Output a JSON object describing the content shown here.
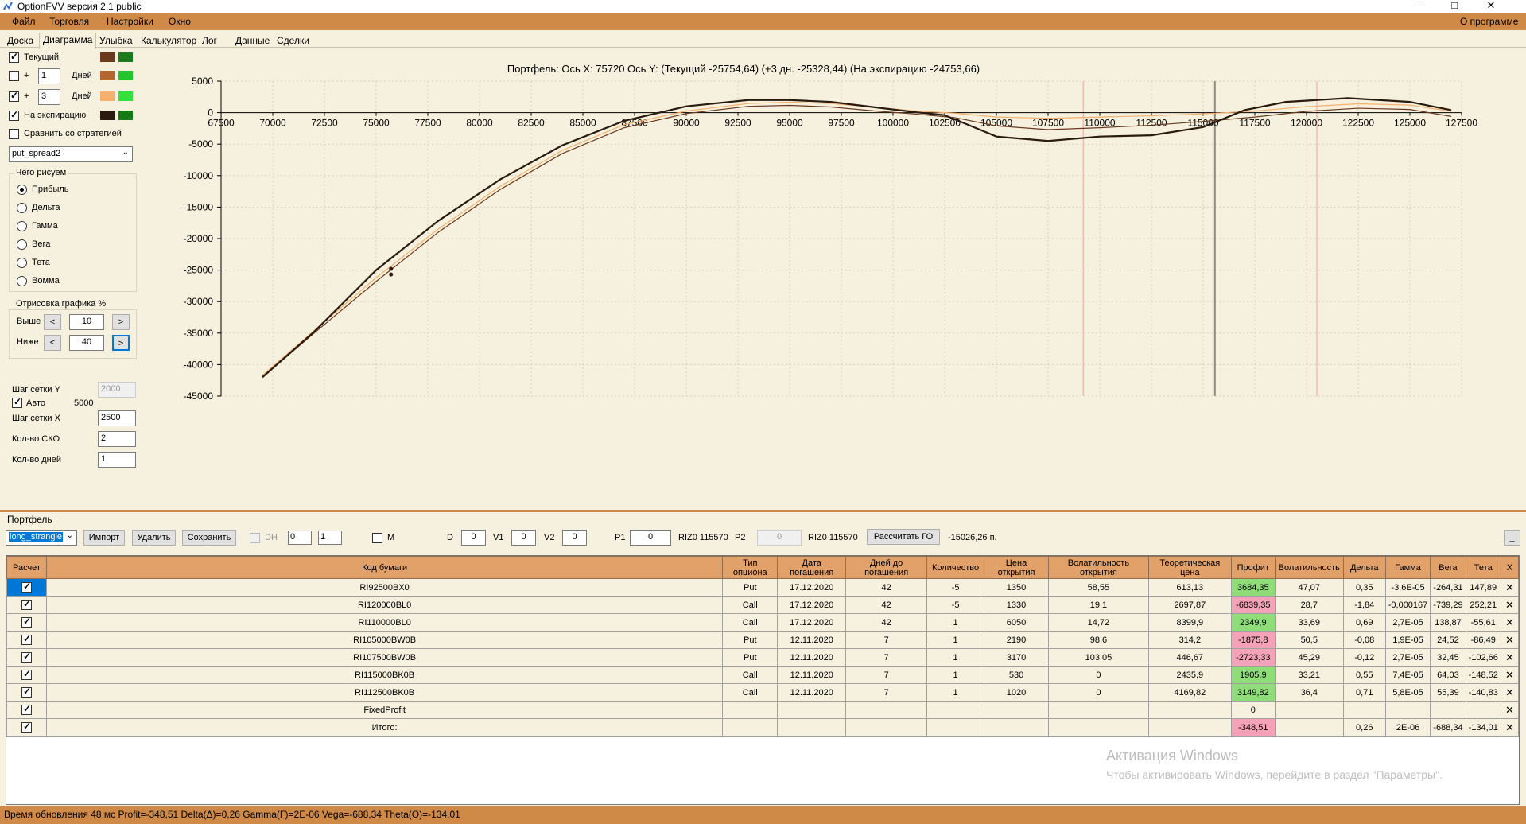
{
  "window": {
    "title": "OptionFVV версия 2.1 public",
    "minimize": "–",
    "maximize": "□",
    "close": "✕"
  },
  "menu": {
    "items": [
      "Файл",
      "Торговля",
      "Настройки",
      "Окно"
    ],
    "about": "О программе"
  },
  "tabs": [
    "Доска",
    "Диаграмма",
    "Улыбка",
    "Калькулятор",
    "Лог",
    "Данные",
    "Сделки"
  ],
  "active_tab": "Диаграмма",
  "left_panel": {
    "current_label": "Текущий",
    "plus": "+",
    "days_label": "Дней",
    "days1_value": "1",
    "days2_value": "3",
    "expiry_label": "На экспирацию",
    "compare_label": "Сравнить со стратегией",
    "strategy_value": "put_spread2",
    "draw_group_title": "Чего рисуем",
    "draw_options": [
      "Прибыль",
      "Дельта",
      "Гамма",
      "Вега",
      "Тета",
      "Вомма"
    ],
    "render_group_title": "Отрисовка графика %",
    "above_label": "Выше",
    "above_value": "10",
    "below_label": "Ниже",
    "below_value": "40",
    "prev": "<",
    "next": ">",
    "grid_y_label": "Шаг сетки Y",
    "grid_y_value": "2000",
    "auto_label": "Авто",
    "auto_value": "5000",
    "grid_x_label": "Шаг сетки X",
    "grid_x_value": "2500",
    "sko_label": "Кол-во СКО",
    "sko_value": "2",
    "days_count_label": "Кол-во дней",
    "days_count_value": "1",
    "colors": {
      "current_1": "#6B3A1E",
      "current_2": "#1D7A1D",
      "plus1_1": "#B5662E",
      "plus1_2": "#22C52C",
      "plus3_1": "#F5B06E",
      "plus3_2": "#36E03A",
      "expiry_1": "#2A1A10",
      "expiry_2": "#137A16"
    }
  },
  "chart_data": {
    "type": "line",
    "title": "Портфель: Ось X: 75720 Ось Y: (Текущий -25754,64) (+3 дн. -25328,44) (На экспирацию -24753,66)",
    "x_ticks": [
      "67500",
      "70000",
      "72500",
      "75000",
      "77500",
      "80000",
      "82500",
      "85000",
      "87500",
      "90000",
      "92500",
      "95000",
      "97500",
      "100000",
      "102500",
      "105000",
      "107500",
      "110000",
      "112500",
      "115000",
      "117500",
      "120000",
      "122500",
      "125000",
      "127500"
    ],
    "y_ticks": [
      "5000",
      "0",
      "-5000",
      "-10000",
      "-15000",
      "-20000",
      "-25000",
      "-30000",
      "-35000",
      "-40000",
      "-45000"
    ],
    "xlim": [
      67500,
      127500
    ],
    "ylim": [
      -45000,
      5000
    ],
    "grid": true,
    "cursor_x": 75720,
    "sd_lines": [
      109200,
      115570,
      120500
    ],
    "series": [
      {
        "color": "#6B3A1E",
        "x": [
          69500,
          72000,
          75000,
          78000,
          81000,
          84000,
          87000,
          90000,
          93000,
          95000,
          97000,
          99000,
          101000,
          103000,
          105000,
          107500,
          110000,
          112500,
          115000,
          117500,
          120000,
          122500,
          125000,
          127000
        ],
        "y": [
          -42000,
          -35000,
          -26800,
          -19000,
          -12200,
          -6500,
          -2400,
          -150,
          1000,
          1150,
          900,
          300,
          -200,
          -800,
          -2100,
          -2700,
          -2400,
          -2000,
          -1400,
          -700,
          200,
          700,
          500,
          -600
        ]
      },
      {
        "color": "#F5B06E",
        "x": [
          69500,
          72000,
          75000,
          78000,
          81000,
          84000,
          87000,
          90000,
          93000,
          95000,
          97000,
          99000,
          101000,
          103000,
          105000,
          107500,
          110000,
          112500,
          115000,
          117500,
          120000,
          122500,
          125000,
          127000
        ],
        "y": [
          -41700,
          -34600,
          -26200,
          -18500,
          -11700,
          -6000,
          -1900,
          250,
          1450,
          1650,
          1450,
          900,
          300,
          -100,
          -700,
          -900,
          -700,
          -500,
          -200,
          250,
          950,
          1400,
          1200,
          200
        ]
      },
      {
        "color": "#2A1A10",
        "x": [
          69500,
          72000,
          75000,
          78000,
          81000,
          84000,
          87000,
          90000,
          93000,
          95000,
          97000,
          99000,
          101000,
          102500,
          105000,
          107500,
          110000,
          112500,
          115000,
          117000,
          119000,
          122000,
          125000,
          127000
        ],
        "y": [
          -42000,
          -34800,
          -25000,
          -17200,
          -10600,
          -5200,
          -1300,
          1000,
          2000,
          2000,
          1700,
          900,
          100,
          -400,
          -3800,
          -4500,
          -3800,
          -3600,
          -2300,
          400,
          1700,
          2300,
          1700,
          400
        ]
      }
    ]
  },
  "portfolio": {
    "label": "Портфель",
    "select_value": "long_strangle",
    "import": "Импорт",
    "delete": "Удалить",
    "save": "Сохранить",
    "dh_label": "DH",
    "dh_val1": "0",
    "dh_val2": "1",
    "m_label": "M",
    "d_label": "D",
    "d_value": "0",
    "v1_label": "V1",
    "v1_value": "0",
    "v2_label": "V2",
    "v2_value": "0",
    "p1_label": "P1",
    "p1_value": "0",
    "riz1": "RIZ0 115570",
    "p2_label": "P2",
    "p2_value": "0",
    "riz2": "RIZ0 115570",
    "calc_go": "Рассчитать ГО",
    "go_value": "-15026,26 п.",
    "minimize": "_"
  },
  "table": {
    "headers": [
      "Расчет",
      "Код бумаги",
      "Тип опциона",
      "Дата погашения",
      "Дней до погашения",
      "Количество",
      "Цена открытия",
      "Волатильность открытия",
      "Теоретическая цена",
      "Профит",
      "Волатильность",
      "Дельта",
      "Гамма",
      "Вега",
      "Тета",
      "X"
    ],
    "rows": [
      [
        "RI92500BX0",
        "Put",
        "17.12.2020",
        "42",
        "-5",
        "1350",
        "58,55",
        "613,13",
        "3684,35",
        "47,07",
        "0,35",
        "-3,6E-05",
        "-264,31",
        "147,89"
      ],
      [
        "RI120000BL0",
        "Call",
        "17.12.2020",
        "42",
        "-5",
        "1330",
        "19,1",
        "2697,87",
        "-6839,35",
        "28,7",
        "-1,84",
        "-0,000167",
        "-739,29",
        "252,21"
      ],
      [
        "RI110000BL0",
        "Call",
        "17.12.2020",
        "42",
        "1",
        "6050",
        "14,72",
        "8399,9",
        "2349,9",
        "33,69",
        "0,69",
        "2,7E-05",
        "138,87",
        "-55,61"
      ],
      [
        "RI105000BW0B",
        "Put",
        "12.11.2020",
        "7",
        "1",
        "2190",
        "98,6",
        "314,2",
        "-1875,8",
        "50,5",
        "-0,08",
        "1,9E-05",
        "24,52",
        "-86,49"
      ],
      [
        "RI107500BW0B",
        "Put",
        "12.11.2020",
        "7",
        "1",
        "3170",
        "103,05",
        "446,67",
        "-2723,33",
        "45,29",
        "-0,12",
        "2,7E-05",
        "32,45",
        "-102,66"
      ],
      [
        "RI115000BK0B",
        "Call",
        "12.11.2020",
        "7",
        "1",
        "530",
        "0",
        "2435,9",
        "1905,9",
        "33,21",
        "0,55",
        "7,4E-05",
        "64,03",
        "-148,52"
      ],
      [
        "RI112500BK0B",
        "Call",
        "12.11.2020",
        "7",
        "1",
        "1020",
        "0",
        "4169,82",
        "3149,82",
        "36,4",
        "0,71",
        "5,8E-05",
        "55,39",
        "-140,83"
      ],
      [
        "FixedProfit",
        "",
        "",
        "",
        "",
        "",
        "",
        "",
        "0",
        "",
        "",
        "",
        "",
        ""
      ],
      [
        "Итого:",
        "",
        "",
        "",
        "",
        "",
        "",
        "",
        "-348,51",
        "",
        "0,26",
        "2E-06",
        "-688,34",
        "-134,01"
      ]
    ],
    "profit_colors": [
      "pos",
      "neg",
      "pos",
      "neg",
      "neg",
      "pos",
      "pos",
      "",
      "neg"
    ],
    "x_symbol": "✕"
  },
  "watermark": {
    "line1": "Активация Windows",
    "line2": "Чтобы активировать Windows, перейдите в раздел \"Параметры\"."
  },
  "status": "Время обновления 48 мс  Profit=-348,51 Delta(Δ)=0,26 Gamma(Γ)=2E-06 Vega=-688,34 Theta(Θ)=-134,01"
}
